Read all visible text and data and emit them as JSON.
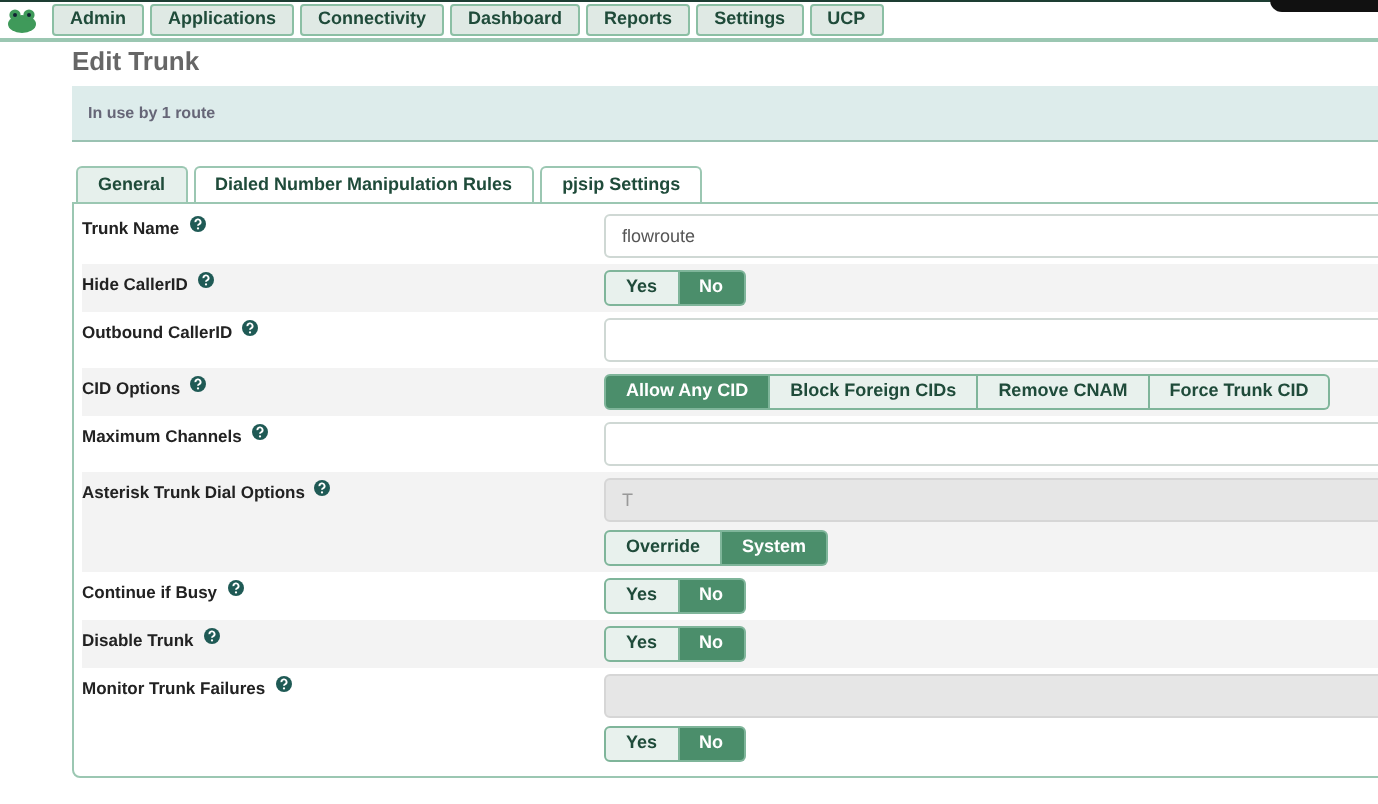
{
  "nav": {
    "items": [
      "Admin",
      "Applications",
      "Connectivity",
      "Dashboard",
      "Reports",
      "Settings",
      "UCP"
    ]
  },
  "page_title": "Edit Trunk",
  "notice": "In use by 1 route",
  "tabs": [
    {
      "label": "General",
      "selected": true
    },
    {
      "label": "Dialed Number Manipulation Rules",
      "selected": false
    },
    {
      "label": "pjsip Settings",
      "selected": false
    }
  ],
  "rows": [
    {
      "kind": "text",
      "label": "Trunk Name",
      "field": {
        "value": "flowroute",
        "disabled": false
      }
    },
    {
      "kind": "toggle",
      "label": "Hide CallerID",
      "options": [
        {
          "label": "Yes",
          "selected": false
        },
        {
          "label": "No",
          "selected": true
        }
      ]
    },
    {
      "kind": "text",
      "label": "Outbound CallerID",
      "field": {
        "disabled": false
      }
    },
    {
      "kind": "toggle",
      "label": "CID Options",
      "options": [
        {
          "label": "Allow Any CID",
          "selected": true
        },
        {
          "label": "Block Foreign CIDs",
          "selected": false
        },
        {
          "label": "Remove CNAM",
          "selected": false
        },
        {
          "label": "Force Trunk CID",
          "selected": false
        }
      ]
    },
    {
      "kind": "text",
      "label": "Maximum Channels",
      "field": {
        "disabled": false
      }
    },
    {
      "kind": "text_toggle",
      "label": "Asterisk Trunk Dial Options",
      "field": {
        "placeholder": "T",
        "disabled": true
      },
      "options": [
        {
          "label": "Override",
          "selected": false
        },
        {
          "label": "System",
          "selected": true
        }
      ]
    },
    {
      "kind": "toggle",
      "label": "Continue if Busy",
      "options": [
        {
          "label": "Yes",
          "selected": false
        },
        {
          "label": "No",
          "selected": true
        }
      ]
    },
    {
      "kind": "toggle",
      "label": "Disable Trunk",
      "options": [
        {
          "label": "Yes",
          "selected": false
        },
        {
          "label": "No",
          "selected": true
        }
      ]
    },
    {
      "kind": "text_toggle",
      "label": "Monitor Trunk Failures",
      "field": {
        "disabled": true
      },
      "options": [
        {
          "label": "Yes",
          "selected": false
        },
        {
          "label": "No",
          "selected": true
        }
      ]
    }
  ]
}
